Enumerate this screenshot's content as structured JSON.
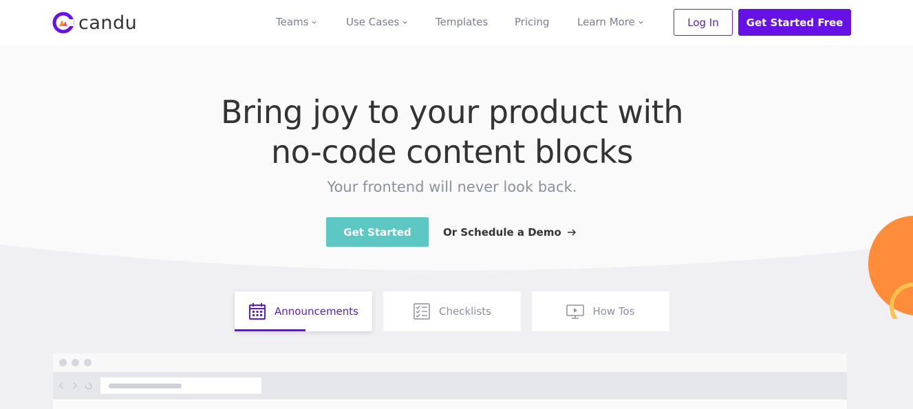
{
  "brand": {
    "name": "candu",
    "accent": "#6612e6",
    "teal": "#5cc7c3",
    "orange": "#ff8c3a"
  },
  "nav": {
    "items": [
      {
        "label": "Teams",
        "dropdown": true
      },
      {
        "label": "Use Cases",
        "dropdown": true
      },
      {
        "label": "Templates",
        "dropdown": false
      },
      {
        "label": "Pricing",
        "dropdown": false
      },
      {
        "label": "Learn More",
        "dropdown": true
      }
    ],
    "login": "Log In",
    "cta": "Get Started Free"
  },
  "hero": {
    "title_line1": "Bring joy to your product with",
    "title_line2": "no-code content blocks",
    "subtitle": "Your frontend will never look back.",
    "primary_cta": "Get Started",
    "secondary_cta": "Or Schedule a Demo"
  },
  "tabs": [
    {
      "label": "Announcements",
      "icon": "calendar-icon",
      "active": true
    },
    {
      "label": "Checklists",
      "icon": "checklist-icon",
      "active": false
    },
    {
      "label": "How Tos",
      "icon": "monitor-play-icon",
      "active": false
    }
  ]
}
